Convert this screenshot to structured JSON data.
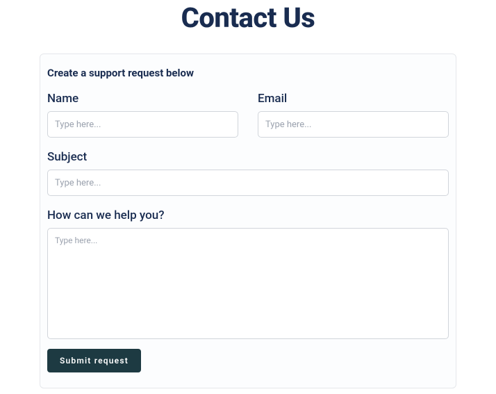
{
  "page": {
    "title": "Contact Us"
  },
  "card": {
    "title": "Create a support request below"
  },
  "form": {
    "name": {
      "label": "Name",
      "placeholder": "Type here...",
      "value": ""
    },
    "email": {
      "label": "Email",
      "placeholder": "Type here...",
      "value": ""
    },
    "subject": {
      "label": "Subject",
      "placeholder": "Type here...",
      "value": ""
    },
    "message": {
      "label": "How can we help you?",
      "placeholder": "Type here...",
      "value": ""
    },
    "submit_label": "Submit request"
  }
}
